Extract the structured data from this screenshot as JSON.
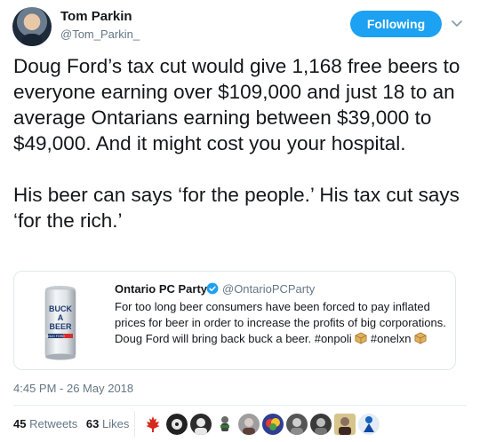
{
  "author": {
    "name": "Tom Parkin",
    "handle": "@Tom_Parkin_"
  },
  "follow_button_label": "Following",
  "tweet_text": "Doug Ford’s tax cut would give 1,168 free beers to everyone earning over $109,000 and just 18 to an average Ontarians earning between $39,000 to $49,000. And it might cost you your hospital.\n\nHis beer can says ‘for the people.’ His tax cut says ‘for the rich.’",
  "quoted_tweet": {
    "name": "Ontario PC Party",
    "handle": "@OntarioPCParty",
    "text": "For too long beer consumers have been forced to pay inflated prices for beer in order to increase the profits of big corporations. Doug Ford will bring back buck a beer. #onpoli",
    "hashtag2": "#onelxn",
    "image_text": [
      "BUCK",
      "A",
      "BEER"
    ],
    "image_small_text": "DOUG FORD"
  },
  "timestamp": "4:45 PM - 26 May 2018",
  "stats": {
    "retweets_count": "45",
    "retweets_label": "Retweets",
    "likes_count": "63",
    "likes_label": "Likes"
  },
  "colors": {
    "accent": "#1da1f2",
    "secondary_text": "#657786",
    "text": "#14171a",
    "border": "#e1e8ed",
    "verified": "#1da1f2"
  },
  "likers": [
    "maple-leaf-avatar",
    "record-avatar",
    "portrait-avatar",
    "figure-avatar",
    "portrait-avatar",
    "balloon-avatar",
    "portrait-avatar",
    "portrait-avatar",
    "portrait-avatar",
    "figure-avatar"
  ]
}
